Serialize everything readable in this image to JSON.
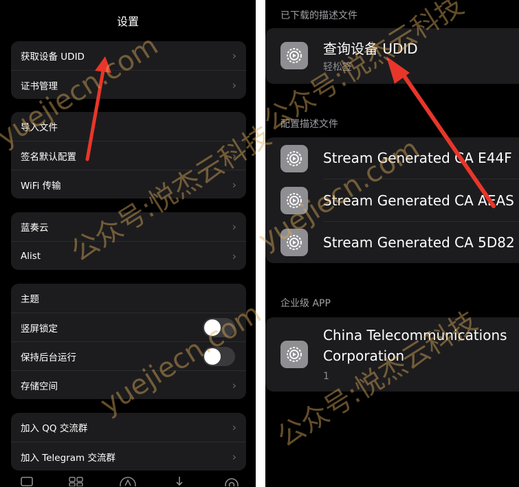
{
  "left": {
    "nav_title": "设置",
    "groups": [
      {
        "items": [
          {
            "label": "获取设备 UDID"
          },
          {
            "label": "证书管理"
          }
        ]
      },
      {
        "items": [
          {
            "label": "导入文件"
          },
          {
            "label": "签名默认配置"
          },
          {
            "label": "WiFi 传输"
          }
        ]
      },
      {
        "items": [
          {
            "label": "蓝奏云"
          },
          {
            "label": "Alist"
          }
        ]
      },
      {
        "items": [
          {
            "label": "主题"
          },
          {
            "label": "竖屏锁定",
            "toggle": false
          },
          {
            "label": "保持后台运行",
            "toggle": false
          },
          {
            "label": "存储空间"
          }
        ]
      },
      {
        "items": [
          {
            "label": "加入 QQ 交流群"
          },
          {
            "label": "加入 Telegram 交流群"
          }
        ]
      }
    ],
    "tabs": [
      "list-icon",
      "grid-icon",
      "app-store-icon",
      "download-icon",
      "gear-icon"
    ]
  },
  "right": {
    "downloaded_label": "已下载的描述文件",
    "downloaded_profile": {
      "title": "查询设备 UDID",
      "subtitle": "轻松签"
    },
    "config_label": "配置描述文件",
    "config_profiles": [
      {
        "title": "Stream Generated CA E44F"
      },
      {
        "title": "Stream Generated CA AEAS"
      },
      {
        "title": "Stream Generated CA 5D82"
      }
    ],
    "enterprise_label": "企业级 APP",
    "enterprise_app": {
      "title_line1": "China Telecommunications",
      "title_line2": "Corporation",
      "count": "1"
    }
  },
  "watermarks": [
    "yuejiecn.com",
    "公众号:悦杰云科技",
    "yuejiecn.com",
    "公众号:悦杰云科技",
    "yuejiecn.com",
    "公众号:悦杰云科技"
  ],
  "colors": {
    "background": "#000000",
    "cell": "#1c1c1e",
    "arrow": "#e8362a",
    "watermark": "#dcaa5a"
  }
}
